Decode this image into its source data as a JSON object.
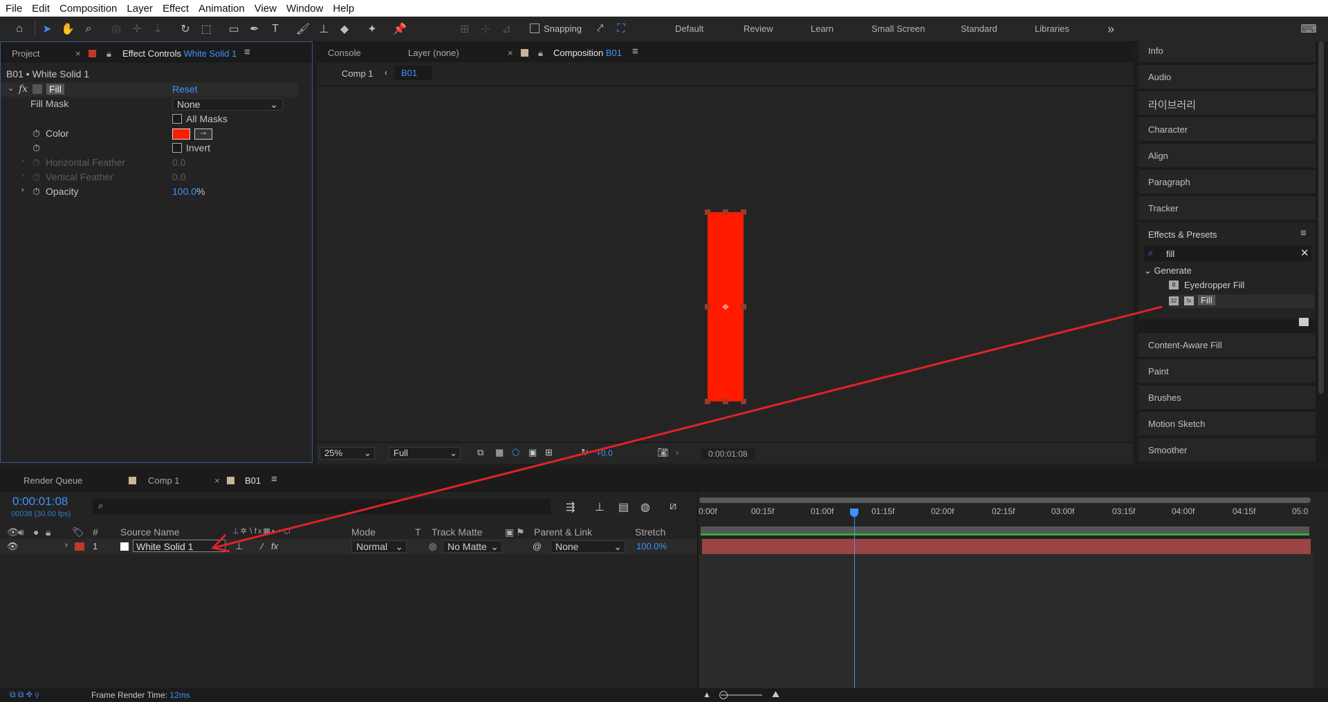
{
  "menu": [
    "File",
    "Edit",
    "Composition",
    "Layer",
    "Effect",
    "Animation",
    "View",
    "Window",
    "Help"
  ],
  "toolbar": {
    "snapping_label": "Snapping",
    "workspaces": [
      "Default",
      "Review",
      "Learn",
      "Small Screen",
      "Standard",
      "Libraries"
    ]
  },
  "left_panel": {
    "tabs": {
      "project": "Project",
      "effect_controls": "Effect Controls",
      "layer_name": "White Solid 1"
    },
    "breadcrumb": "B01 • White Solid 1",
    "effect": {
      "fx": "fx",
      "name": "Fill",
      "reset": "Reset",
      "fill_mask_label": "Fill Mask",
      "fill_mask_value": "None",
      "all_masks_label": "All Masks",
      "color_label": "Color",
      "color_value": "#ff1a00",
      "invert_label": "Invert",
      "hfeather_label": "Horizontal Feather",
      "hfeather_value": "0.0",
      "vfeather_label": "Vertical Feather",
      "vfeather_value": "0.0",
      "opacity_label": "Opacity",
      "opacity_value": "100.0",
      "opacity_unit": "%"
    }
  },
  "viewer": {
    "tabs": {
      "console": "Console",
      "layer": "Layer (none)",
      "composition": "Composition",
      "comp_name": "B01"
    },
    "nav": {
      "comp1": "Comp 1",
      "b01": "B01"
    },
    "solid_color": "#ff1a00",
    "footer": {
      "zoom": "25%",
      "resolution": "Full",
      "exposure": "+0.0",
      "timecode": "0:00:01:08"
    }
  },
  "right_panel": {
    "items_top": [
      "Info",
      "Audio",
      "라이브러리",
      "Character",
      "Align",
      "Paragraph",
      "Tracker"
    ],
    "effects_presets": {
      "title": "Effects & Presets",
      "search_value": "fill",
      "category": "Generate",
      "results": [
        {
          "label": "Eyedropper Fill",
          "badges": [
            "8"
          ]
        },
        {
          "label": "Fill",
          "badges": [
            "32",
            "fx"
          ]
        }
      ]
    },
    "items_bottom": [
      "Content-Aware Fill",
      "Paint",
      "Brushes",
      "Motion Sketch",
      "Smoother"
    ]
  },
  "timeline": {
    "tabs": {
      "render_queue": "Render Queue",
      "comp1": "Comp 1",
      "b01": "B01"
    },
    "timecode": "0:00:01:08",
    "frames": "00038 (30.00 fps)",
    "columns": {
      "num": "#",
      "source": "Source Name",
      "mode": "Mode",
      "t": "T",
      "track_matte": "Track Matte",
      "parent": "Parent & Link",
      "stretch": "Stretch"
    },
    "layer": {
      "index": "1",
      "name": "White Solid 1",
      "mode": "Normal",
      "track_matte": "No Matte",
      "parent": "None",
      "stretch": "100.0%",
      "label_color": "#c0392b"
    },
    "ruler": [
      "0:00f",
      "00:15f",
      "01:00f",
      "01:15f",
      "02:00f",
      "02:15f",
      "03:00f",
      "03:15f",
      "04:00f",
      "04:15f",
      "05:0"
    ],
    "playhead_seconds": 1.27,
    "duration_seconds": 5
  },
  "status": {
    "label": "Frame Render Time:",
    "value": "12ms"
  }
}
